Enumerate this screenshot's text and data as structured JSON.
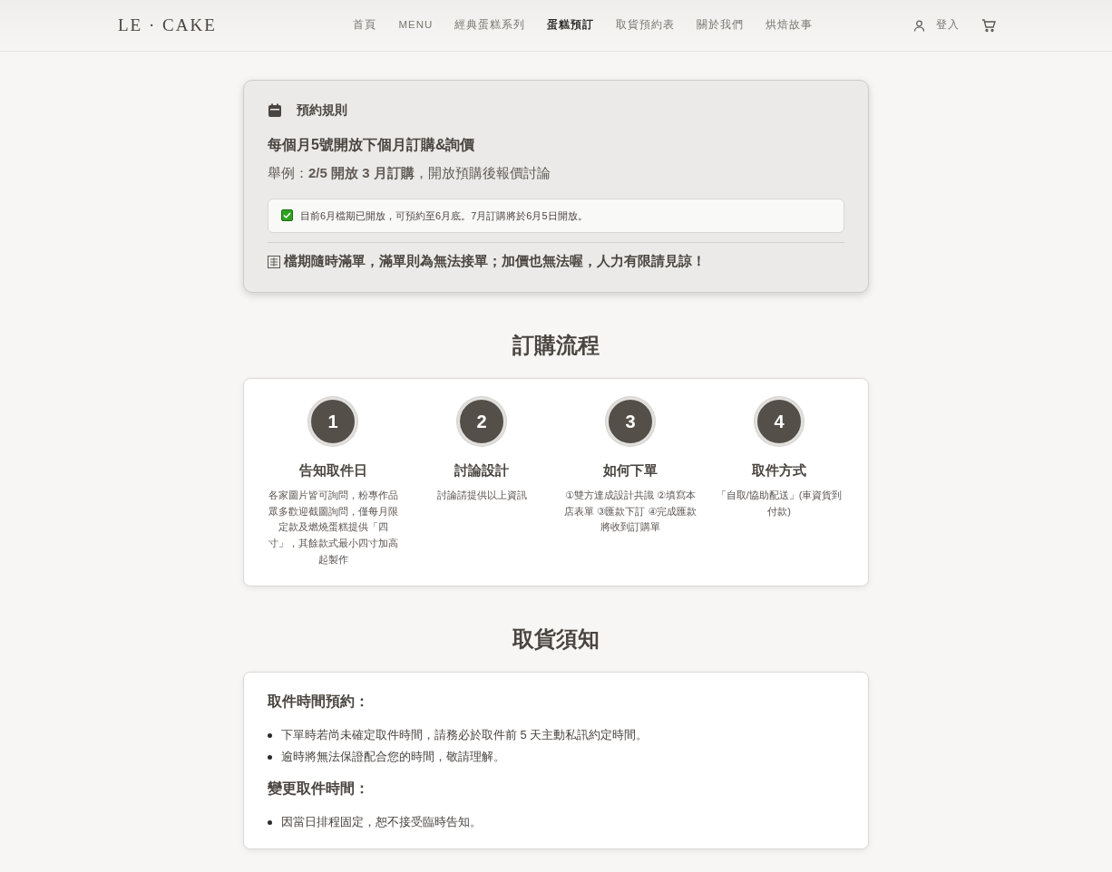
{
  "navbar": {
    "brand": "LE · CAKE",
    "links": [
      {
        "label": "首頁",
        "selected": false
      },
      {
        "label": "MENU",
        "selected": false
      },
      {
        "label": "經典蛋糕系列",
        "selected": false
      },
      {
        "label": "蛋糕預訂",
        "selected": true
      },
      {
        "label": "取貨預約表",
        "selected": false
      },
      {
        "label": "關於我們",
        "selected": false
      },
      {
        "label": "烘焙故事",
        "selected": false
      }
    ],
    "login": "登入"
  },
  "rules": {
    "title": "預約規則",
    "headline": "每個月5號開放下個月訂購&詢價",
    "example": "舉例：**2/5 開放 3 月訂購**，開放預購後報價討論",
    "notice": "目前6月檔期已開放，可預約至6月底。7月訂購將於6月5日開放。",
    "warning": "檔期隨時滿單，滿單則為無法接單；加價也無法喔，人力有限請見諒！"
  },
  "process": {
    "title": "訂購流程",
    "steps": [
      {
        "number": "1",
        "title": "告知取件日",
        "text": "各家圖片皆可詢問，粉專作品眾多歡迎截圖詢問，僅每月限定款及燃燒蛋糕提供「四寸」，其餘款式最小四寸加高起製作"
      },
      {
        "number": "2",
        "title": "討論設計",
        "text": "討論請提供以上資訊"
      },
      {
        "number": "3",
        "title": "如何下單",
        "text": "①雙方達成設計共識 ②填寫本店表單 ③匯款下訂 ④完成匯款將收到訂購單"
      },
      {
        "number": "4",
        "title": "取件方式",
        "text": "「自取/協助配送」(車資貨到付款)"
      }
    ]
  },
  "pickup": {
    "title": "取貨須知",
    "sections": [
      {
        "heading": "取件時間預約：",
        "items": [
          "下單時若尚未確定取件時間，請務必於取件前 5 天主動私訊約定時間。",
          "逾時將無法保證配合您的時間，敬請理解。"
        ]
      },
      {
        "heading": "變更取件時間：",
        "items": [
          "因當日排程固定，恕不接受臨時告知。"
        ]
      }
    ]
  }
}
